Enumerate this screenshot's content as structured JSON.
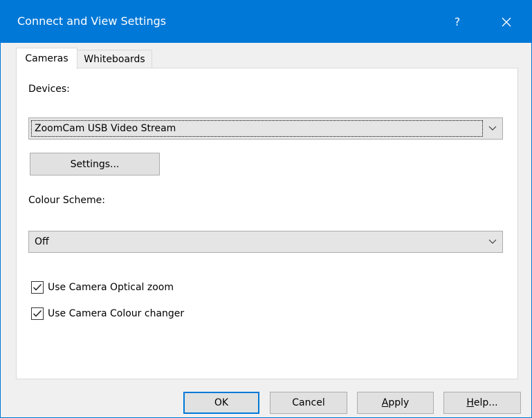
{
  "window": {
    "title": "Connect and View Settings",
    "help_glyph": "?",
    "close_icon": "close-icon"
  },
  "tabs": [
    {
      "label": "Cameras",
      "active": true
    },
    {
      "label": "Whiteboards",
      "active": false
    }
  ],
  "devices": {
    "label": "Devices:",
    "selected": "ZoomCam USB Video Stream",
    "settings_button": "Settings..."
  },
  "colour_scheme": {
    "label": "Colour Scheme:",
    "selected": "Off"
  },
  "options": [
    {
      "label": "Use Camera Optical zoom",
      "checked": true
    },
    {
      "label": "Use Camera Colour changer",
      "checked": true
    }
  ],
  "footer": {
    "ok": "OK",
    "cancel": "Cancel",
    "apply_first": "A",
    "apply_rest": "pply",
    "help_first": "H",
    "help_rest": "elp..."
  },
  "colors": {
    "accent": "#0078d7",
    "panel": "#ffffff",
    "background": "#f0f0f0"
  }
}
